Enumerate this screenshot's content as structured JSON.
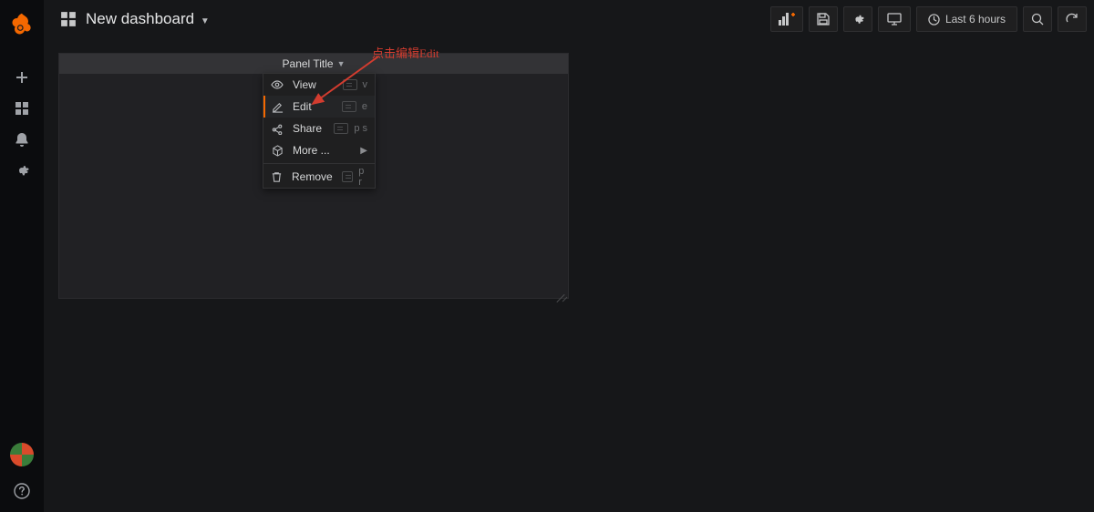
{
  "dashboard_title": "New dashboard",
  "time_range": "Last 6 hours",
  "panel": {
    "title": "Panel Title"
  },
  "annotation": "点击编辑Edit",
  "menu": {
    "view": {
      "label": "View",
      "shortcut": "v"
    },
    "edit": {
      "label": "Edit",
      "shortcut": "e"
    },
    "share": {
      "label": "Share",
      "shortcut": "p s"
    },
    "more": {
      "label": "More ..."
    },
    "remove": {
      "label": "Remove",
      "shortcut": "p r"
    }
  }
}
